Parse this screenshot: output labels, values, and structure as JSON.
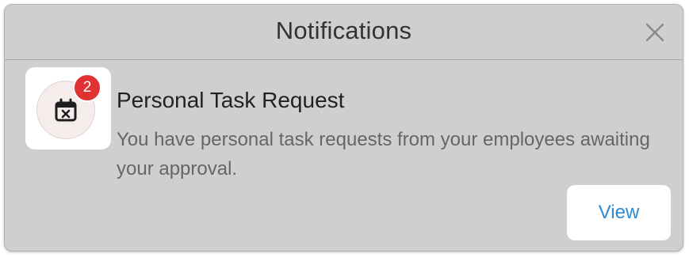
{
  "dialog": {
    "title": "Notifications",
    "close_icon": "close-icon"
  },
  "notification": {
    "icon": "calendar-x-icon",
    "badge_count": "2",
    "badge_color": "#e03232",
    "title": "Personal Task Request",
    "description": "You have personal task requests from your employees awaiting your approval.",
    "action_label": "View",
    "action_color": "#2b8ad4"
  }
}
